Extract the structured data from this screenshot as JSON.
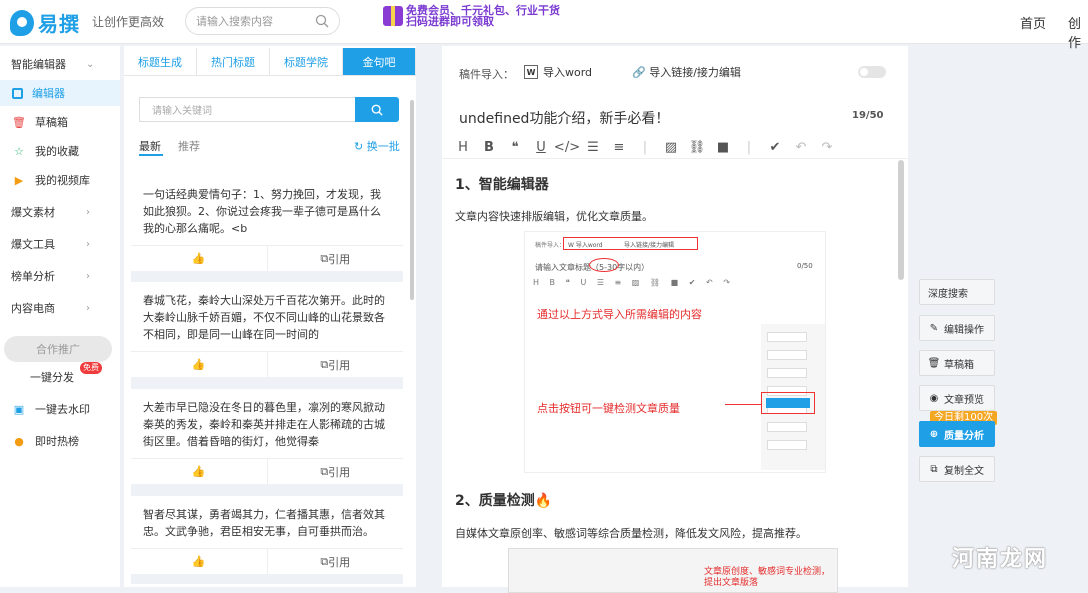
{
  "header": {
    "logo": "易撰",
    "slogan": "让创作更高效",
    "search_placeholder": "请输入搜索内容",
    "promo_line1": "免费会员、千元礼包、行业干货",
    "promo_line2": "扫码进群即可领取",
    "nav_home": "首页",
    "nav_create": "创作"
  },
  "sidebar": {
    "smart_editor": "智能编辑器",
    "editor": "编辑器",
    "drafts": "草稿箱",
    "favorites": "我的收藏",
    "videos": "我的视频库",
    "materials": "爆文素材",
    "tools": "爆文工具",
    "rankings": "榜单分析",
    "ecommerce": "内容电商",
    "promo": "合作推广",
    "one_click_distribute": "一键分发",
    "free_badge": "免费",
    "watermark": "一键去水印",
    "hot_list": "即时热榜"
  },
  "quotes": {
    "tabs": [
      "标题生成",
      "热门标题",
      "标题学院",
      "金句吧"
    ],
    "keyword_placeholder": "请输入关键词",
    "sub_tabs": [
      "最新",
      "推荐"
    ],
    "refresh": "换一批",
    "like": "",
    "quote_label": "引用",
    "items": [
      "一句话经典爱情句子：1、努力挽回，才发现，我如此狼狈。2、你说过会疼我一辈子德可是爲什么我的心那么痛呢。<b",
      "春城飞花，秦岭大山深处万千百花次第开。此时的大秦岭山脉千娇百媚，不仅不同山峰的山花景致各不相同，即是同一山峰在同一时间的",
      "大差市早已隐没在冬日的暮色里，凛冽的寒风掀动秦英的秀发，秦岭和秦英并排走在人影稀疏的古城街区里。借着昏暗的街灯，他觉得秦",
      "智者尽其谋，勇者竭其力，仁者播其惠，信者效其忠。文武争驰，君臣相安无事，自可垂拱而治。"
    ]
  },
  "editor": {
    "import_label": "稿件导入：",
    "import_word": "导入word",
    "import_link": "导入链接/接力编辑",
    "title": "undefined功能介绍，新手必看！",
    "counter": "19/50",
    "heading1": "1、智能编辑器",
    "para1": "文章内容快速排版编辑，优化文章质量。",
    "shot1_import": "稿件导入：",
    "shot1_word": "W 导入word",
    "shot1_link": "导入链接/接力编辑",
    "shot1_title": "请输入文章标题（5-30字以内）",
    "shot1_count": "0/50",
    "shot1_note1": "通过以上方式导入所需编辑的内容",
    "shot1_note2": "点击按钮可一键检测文章质量",
    "heading2": "2、质量检测🔥",
    "para2": "自媒体文章原创率、敏感词等综合质量检测，降低发文风险，提高推荐。",
    "shot2_text1": "文章原创度、敏感词专业检测，",
    "shot2_text2": "提出文章版落"
  },
  "rightbar": {
    "deep_search": "深度搜索",
    "edit_ops": "编辑操作",
    "drafts": "草稿箱",
    "preview": "文章预览",
    "today_left": "今日剩100次",
    "quality": "质量分析",
    "copy_all": "复制全文"
  },
  "watermark_text": "河南龙网",
  "colors": {
    "accent": "#1e9fe6",
    "red": "#e52b2b",
    "orange": "#f5a623"
  }
}
